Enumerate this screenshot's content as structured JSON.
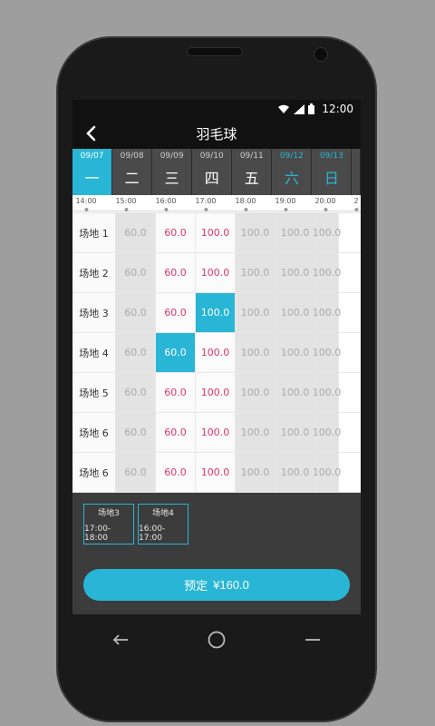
{
  "status": {
    "time": "12:00"
  },
  "header": {
    "title": "羽毛球"
  },
  "days": [
    {
      "date": "09/07",
      "weekday": "一"
    },
    {
      "date": "09/08",
      "weekday": "二"
    },
    {
      "date": "09/09",
      "weekday": "三"
    },
    {
      "date": "09/10",
      "weekday": "四"
    },
    {
      "date": "09/11",
      "weekday": "五"
    },
    {
      "date": "09/12",
      "weekday": "六"
    },
    {
      "date": "09/13",
      "weekday": "日"
    }
  ],
  "timeline": [
    "14:00",
    "15:00",
    "16:00",
    "17:00",
    "18:00",
    "19:00",
    "20:00",
    "2"
  ],
  "courts": [
    {
      "label": "场地 1",
      "prices": [
        "60.0",
        "60.0",
        "100.0",
        "100.0",
        "100.0",
        "100.0"
      ]
    },
    {
      "label": "场地 2",
      "prices": [
        "60.0",
        "60.0",
        "100.0",
        "100.0",
        "100.0",
        "100.0"
      ]
    },
    {
      "label": "场地 3",
      "prices": [
        "60.0",
        "60.0",
        "100.0",
        "100.0",
        "100.0",
        "100.0"
      ]
    },
    {
      "label": "场地 4",
      "prices": [
        "60.0",
        "60.0",
        "100.0",
        "100.0",
        "100.0",
        "100.0"
      ]
    },
    {
      "label": "场地 5",
      "prices": [
        "60.0",
        "60.0",
        "100.0",
        "100.0",
        "100.0",
        "100.0"
      ]
    },
    {
      "label": "场地 6",
      "prices": [
        "60.0",
        "60.0",
        "100.0",
        "100.0",
        "100.0",
        "100.0"
      ]
    },
    {
      "label": "场地 6",
      "prices": [
        "60.0",
        "60.0",
        "100.0",
        "100.0",
        "100.0",
        "100.0"
      ]
    }
  ],
  "selected_chips": [
    {
      "court": "场地3",
      "time": "17:00-18:00"
    },
    {
      "court": "场地4",
      "time": "16:00-17:00"
    }
  ],
  "book_button": {
    "label": "预定",
    "price": "¥160.0"
  },
  "colors": {
    "accent": "#29b6d6",
    "price_open": "#e0356a"
  },
  "icons": {
    "back": "back-arrow-icon",
    "wifi": "wifi-icon",
    "signal": "signal-icon",
    "battery": "battery-icon"
  }
}
